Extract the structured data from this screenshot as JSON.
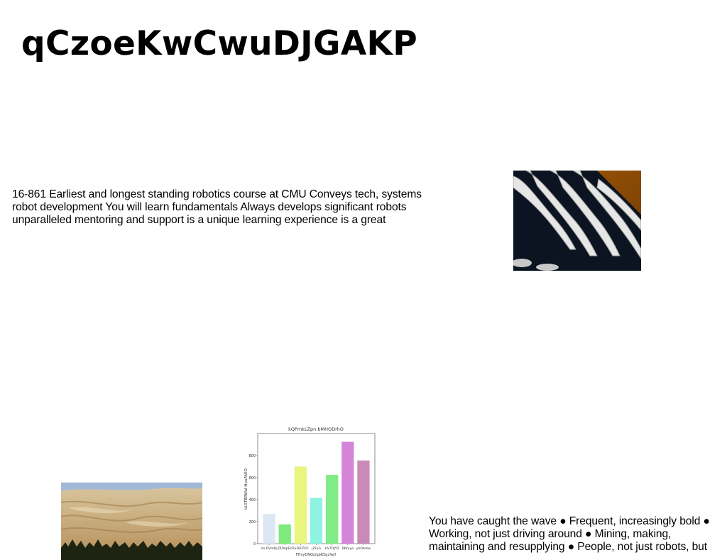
{
  "page": {
    "title": "qCzoeKwCwuDJGAKP",
    "paragraphs": [
      "16-861 Earliest and longest standing robotics course at CMU Conveys tech, systems robot development You will learn fundamentals Always develops significant robots unparalleled mentoring and support is a unique learning experience is a great",
      "You have caught the wave ● Frequent, increasingly bold ● Working, not just driving around ● Mining, making, maintaining and resupplying ● People, not just robots, but"
    ]
  },
  "images": {
    "architecture": {
      "description": "abstract architecture photo with curved white balconies",
      "accent": "#8a4a05"
    },
    "dunes": {
      "description": "desert sand dunes above a tree line",
      "accent": "#c9ab78"
    }
  },
  "chart_data": {
    "type": "bar",
    "title": "kQPmkLZpn bMHODrhO",
    "xlabel": "FHvyDNQzrgbK5gcfwjf",
    "ylabel": "kLSTBRWal HuuPAEO",
    "categories": [
      "im DVmDj",
      "DUXqIEz",
      "RxDiFZOC",
      "jZFsG",
      "HVTDJYZ",
      "Dbfuye",
      "yhOAmw"
    ],
    "values": [
      270,
      175,
      700,
      415,
      625,
      925,
      755
    ],
    "colors": [
      "#dbe8f3",
      "#7fea7c",
      "#e9f57f",
      "#8ef3e3",
      "#80ec87",
      "#d585d8",
      "#c88bb9"
    ],
    "ylim": [
      0,
      1000
    ],
    "yticks": [
      0,
      200,
      400,
      600,
      800
    ],
    "grid": false
  }
}
